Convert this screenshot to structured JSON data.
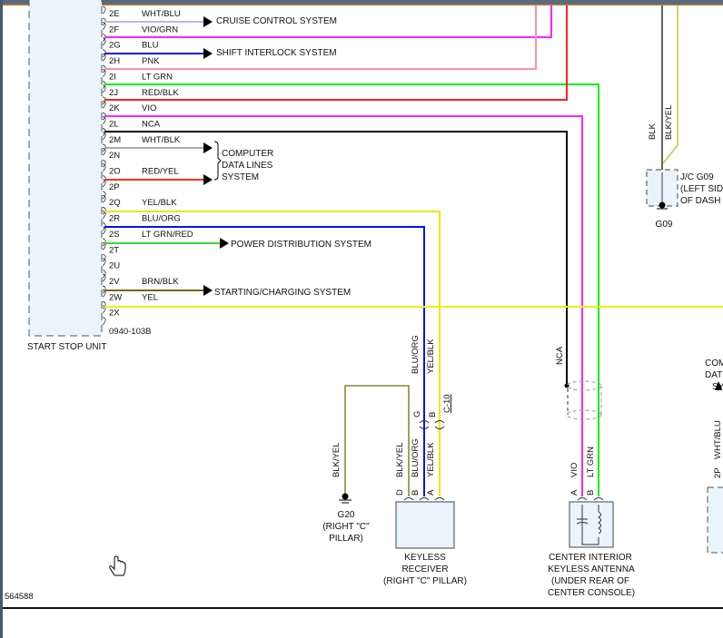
{
  "module": {
    "name": "START STOP UNIT",
    "connector": "0940-103B",
    "pins": [
      {
        "pin": "2E",
        "wire": "WHT/BLU",
        "color": "#b8b8f0"
      },
      {
        "pin": "2F",
        "wire": "VIO/GRN",
        "color": "#ff22ff"
      },
      {
        "pin": "2G",
        "wire": "BLU",
        "color": "#0010ff"
      },
      {
        "pin": "2H",
        "wire": "PNK",
        "color": "#ff8fa8"
      },
      {
        "pin": "2I",
        "wire": "LT GRN",
        "color": "#00ee00"
      },
      {
        "pin": "2J",
        "wire": "RED/BLK",
        "color": "#ff2020"
      },
      {
        "pin": "2K",
        "wire": "VIO",
        "color": "#ff22ff"
      },
      {
        "pin": "2L",
        "wire": "NCA",
        "color": "#000000"
      },
      {
        "pin": "2M",
        "wire": "WHT/BLK",
        "color": "#aaaaaa"
      },
      {
        "pin": "2N",
        "wire": "",
        "color": ""
      },
      {
        "pin": "2O",
        "wire": "RED/YEL",
        "color": "#ff3010"
      },
      {
        "pin": "2P",
        "wire": "",
        "color": ""
      },
      {
        "pin": "2Q",
        "wire": "YEL/BLK",
        "color": "#f0f000"
      },
      {
        "pin": "2R",
        "wire": "BLU/ORG",
        "color": "#0010ff"
      },
      {
        "pin": "2S",
        "wire": "LT GRN/RED",
        "color": "#33dd33"
      },
      {
        "pin": "2T",
        "wire": "",
        "color": ""
      },
      {
        "pin": "2U",
        "wire": "",
        "color": ""
      },
      {
        "pin": "2V",
        "wire": "BRN/BLK",
        "color": "#806020"
      },
      {
        "pin": "2W",
        "wire": "YEL",
        "color": "#f0f000"
      },
      {
        "pin": "2X",
        "wire": "",
        "color": ""
      }
    ]
  },
  "systems": {
    "cruise": "CRUISE CONTROL SYSTEM",
    "shift": "SHIFT INTERLOCK SYSTEM",
    "computer": [
      "COMPUTER",
      "DATA LINES",
      "SYSTEM"
    ],
    "power": "POWER DISTRIBUTION SYSTEM",
    "starting": "STARTING/CHARGING SYSTEM"
  },
  "receiver": {
    "label": [
      "KEYLESS",
      "RECEIVER",
      "(RIGHT \"C\" PILLAR)"
    ],
    "upper_wires": [
      "BLU/ORG",
      "YEL/BLK"
    ],
    "inline_pins": [
      "G",
      "B"
    ],
    "inline_connector": "C-10",
    "pins": [
      "D",
      "B",
      "A"
    ],
    "wires": [
      "BLK/YEL",
      "BLU/ORG",
      "YEL/BLK"
    ]
  },
  "ground_g20": {
    "wire": "BLK/YEL",
    "label": [
      "G20",
      "(RIGHT \"C\"",
      "PILLAR)"
    ]
  },
  "antenna": {
    "label": [
      "CENTER INTERIOR",
      "KEYLESS ANTENNA",
      "(UNDER REAR OF",
      "CENTER CONSOLE)"
    ],
    "shield_wire": "NCA",
    "pins": [
      "A",
      "B"
    ],
    "wires": [
      "VIO",
      "LT GRN"
    ]
  },
  "junction": {
    "wires": [
      "BLK",
      "BLK/YEL"
    ],
    "label": [
      "J/C G09",
      "(LEFT SIDE",
      "OF DASH"
    ],
    "ground": "G09"
  },
  "partial_right": {
    "label": [
      "COM",
      "DAT",
      "SY"
    ],
    "wire": "WHT/BLU",
    "pin": "2P"
  },
  "figure_id": "564588"
}
